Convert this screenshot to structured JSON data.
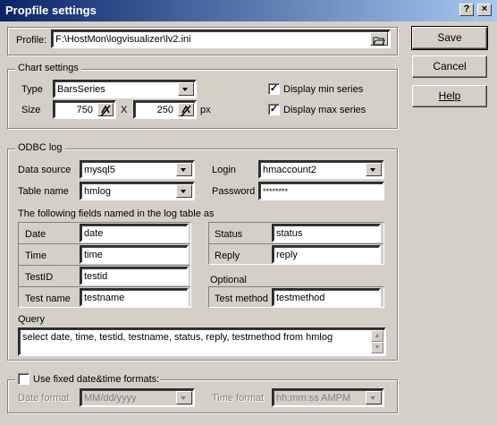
{
  "window": {
    "title": "Propfile settings",
    "close_glyph": "×",
    "help_glyph": "?"
  },
  "profile": {
    "label": "Profile:",
    "value": "F:\\HostMon\\logvisualizer\\lv2.ini"
  },
  "chart_settings": {
    "legend": "Chart settings",
    "type_label": "Type",
    "type_value": "BarsSeries",
    "size_label": "Size",
    "width": "750",
    "times": "X",
    "height": "250",
    "unit": "px",
    "display_min": {
      "label": "Display min series",
      "checked": true
    },
    "display_max": {
      "label": "Display max series",
      "checked": true
    }
  },
  "odbc": {
    "legend": "ODBC log",
    "data_source_label": "Data source",
    "data_source": "mysql5",
    "table_name_label": "Table name",
    "table_name": "hmlog",
    "login_label": "Login",
    "login": "hmaccount2",
    "password_label": "Password",
    "password": "********",
    "fields_caption": "The following fields named in the log table as",
    "fields": {
      "date": {
        "label": "Date",
        "value": "date"
      },
      "time": {
        "label": "Time",
        "value": "time"
      },
      "testid": {
        "label": "TestID",
        "value": "testid"
      },
      "testname": {
        "label": "Test name",
        "value": "testname"
      },
      "status": {
        "label": "Status",
        "value": "status"
      },
      "reply": {
        "label": "Reply",
        "value": "reply"
      },
      "optional": "Optional",
      "testmethod": {
        "label": "Test method",
        "value": "testmethod"
      }
    },
    "query_label": "Query",
    "query": "select date, time, testid, testname, status, reply, testmethod from hmlog"
  },
  "formats": {
    "use_fixed": {
      "label": "Use fixed date&time formats:",
      "checked": false
    },
    "date_label": "Date format",
    "date_value": "MM/dd/yyyy",
    "time_label": "Time format",
    "time_value": "hh:mm:ss AMPM"
  },
  "buttons": {
    "save": "Save",
    "cancel": "Cancel",
    "help": "Help"
  },
  "colors": {
    "titlebar_start": "#0a246a",
    "titlebar_end": "#a6caf0",
    "face": "#d4d0c8"
  }
}
